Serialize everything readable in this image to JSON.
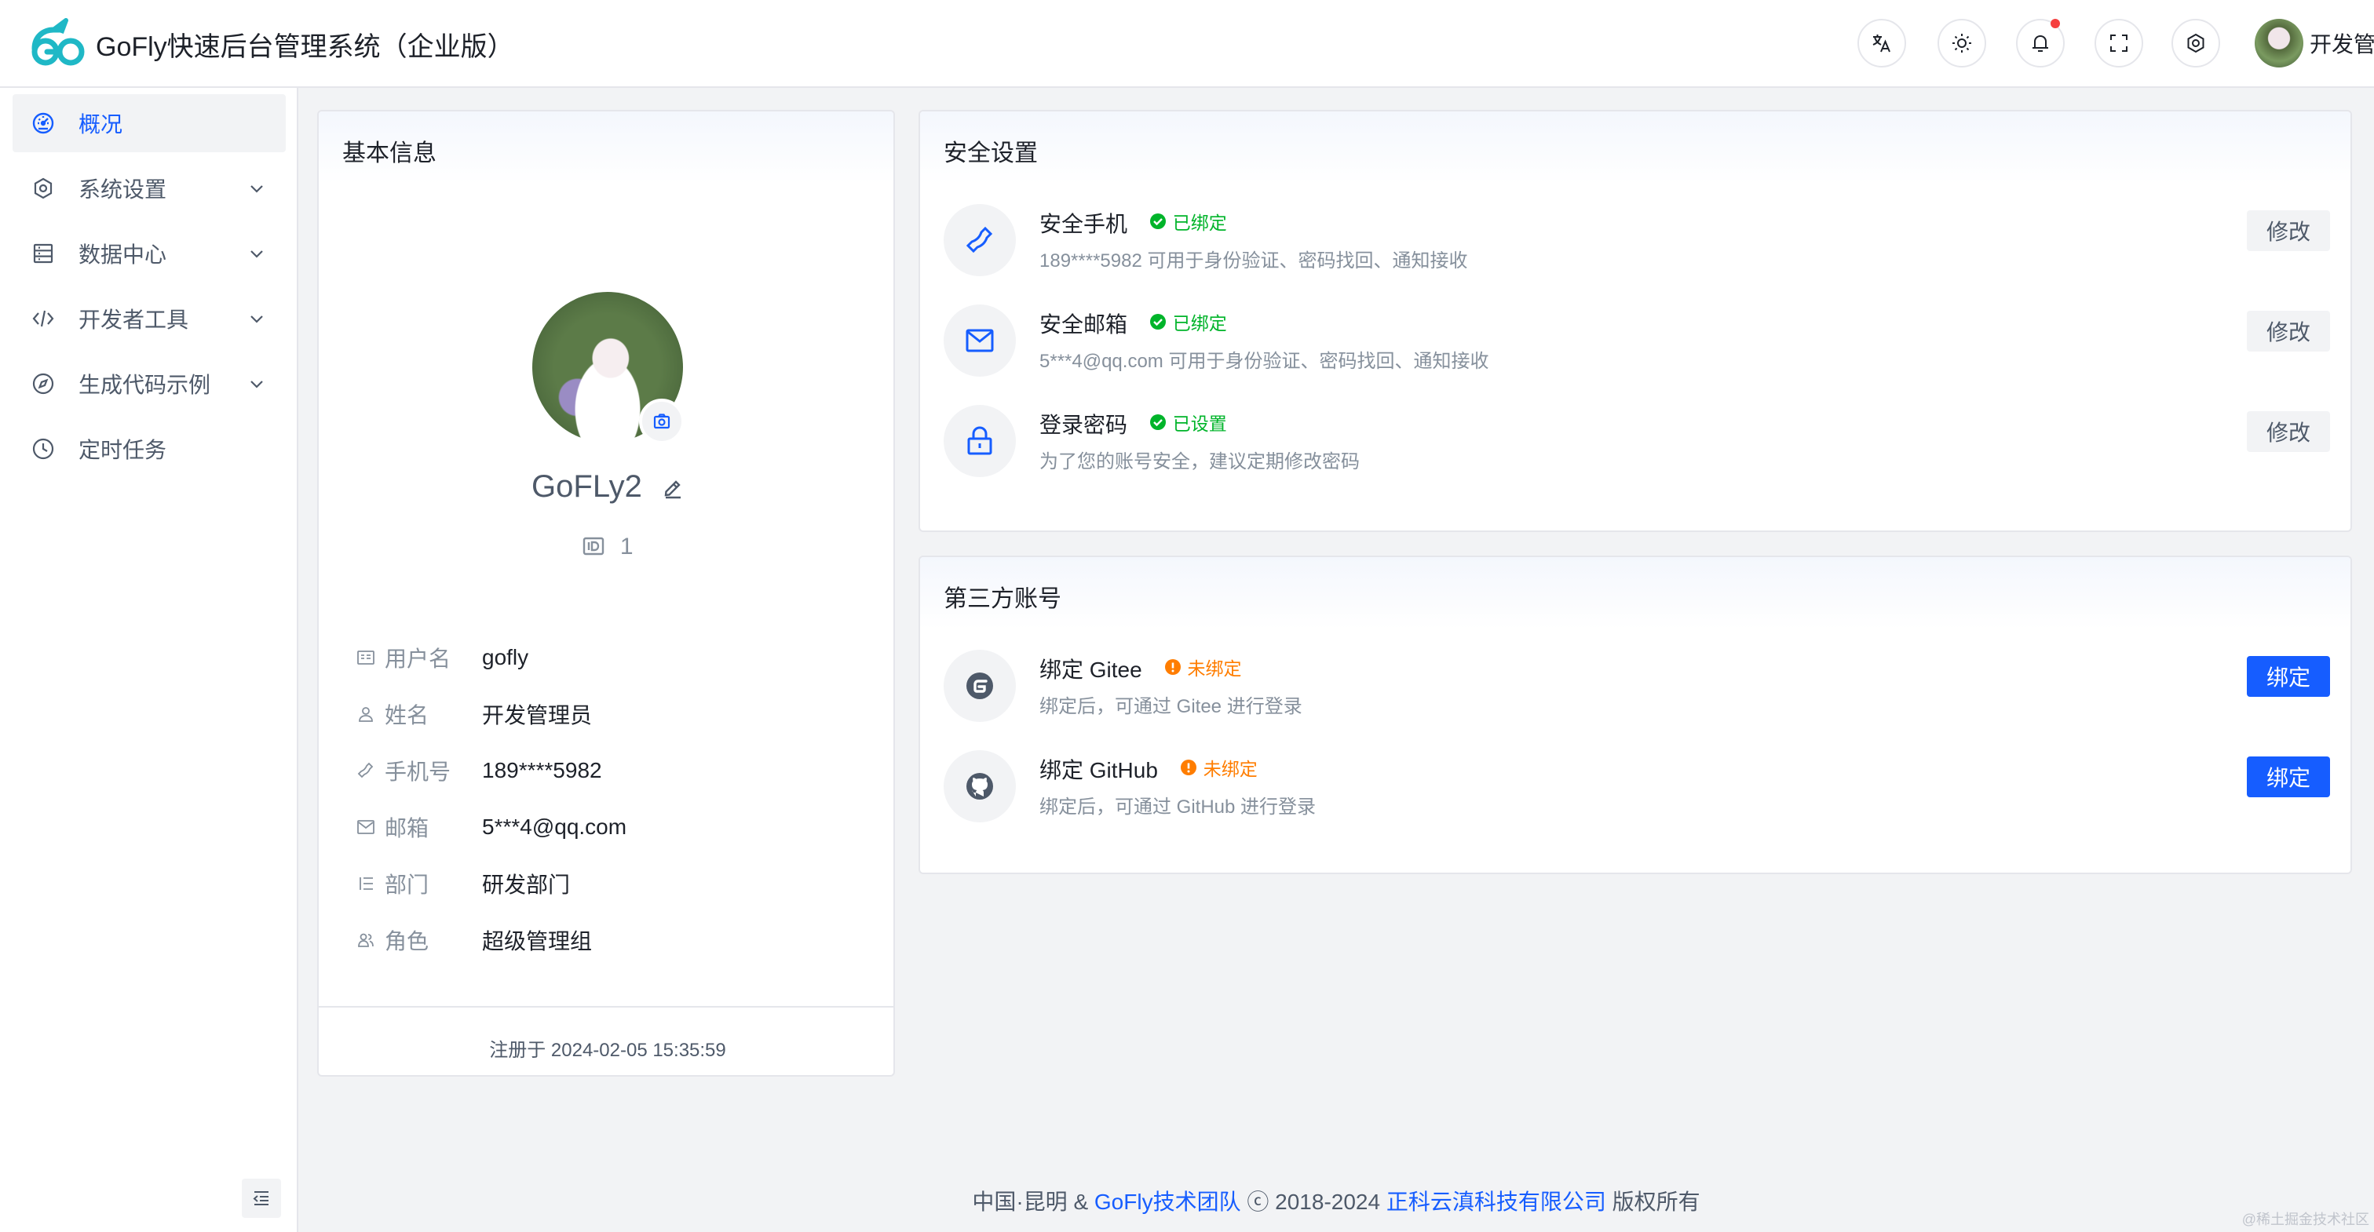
{
  "app": {
    "title": "GoFly快速后台管理系统（企业版）"
  },
  "header": {
    "user_name": "开发管理员",
    "icons": [
      "translate-icon",
      "theme-sun-icon",
      "bell-icon",
      "fullscreen-icon",
      "settings-gear-icon",
      "chevron-down-icon"
    ]
  },
  "sidebar": {
    "items": [
      {
        "label": "概况",
        "icon": "dashboard-icon",
        "active": true,
        "has_children": false
      },
      {
        "label": "系统设置",
        "icon": "gear-icon",
        "active": false,
        "has_children": true
      },
      {
        "label": "数据中心",
        "icon": "database-icon",
        "active": false,
        "has_children": true
      },
      {
        "label": "开发者工具",
        "icon": "code-icon",
        "active": false,
        "has_children": true
      },
      {
        "label": "生成代码示例",
        "icon": "compass-icon",
        "active": false,
        "has_children": true
      },
      {
        "label": "定时任务",
        "icon": "clock-icon",
        "active": false,
        "has_children": false
      }
    ]
  },
  "profile": {
    "card_title": "基本信息",
    "nickname": "GoFLy2",
    "id_value": "1",
    "fields": [
      {
        "label": "用户名",
        "value": "gofly",
        "icon": "id-card-icon"
      },
      {
        "label": "姓名",
        "value": "开发管理员",
        "icon": "user-icon"
      },
      {
        "label": "手机号",
        "value": "189****5982",
        "icon": "phone-icon"
      },
      {
        "label": "邮箱",
        "value": "5***4@qq.com",
        "icon": "mail-icon"
      },
      {
        "label": "部门",
        "value": "研发部门",
        "icon": "list-icon"
      },
      {
        "label": "角色",
        "value": "超级管理组",
        "icon": "user-group-icon"
      }
    ],
    "registered": "注册于 2024-02-05 15:35:59"
  },
  "security": {
    "card_title": "安全设置",
    "items": [
      {
        "title": "安全手机",
        "status": "已绑定",
        "desc": "189****5982 可用于身份验证、密码找回、通知接收",
        "button": "修改",
        "icon": "phone-icon"
      },
      {
        "title": "安全邮箱",
        "status": "已绑定",
        "desc": "5***4@qq.com 可用于身份验证、密码找回、通知接收",
        "button": "修改",
        "icon": "mail-icon"
      },
      {
        "title": "登录密码",
        "status": "已设置",
        "desc": "为了您的账号安全，建议定期修改密码",
        "button": "修改",
        "icon": "lock-icon"
      }
    ]
  },
  "third_party": {
    "card_title": "第三方账号",
    "items": [
      {
        "title": "绑定 Gitee",
        "status": "未绑定",
        "desc": "绑定后，可通过 Gitee 进行登录",
        "button": "绑定",
        "icon": "gitee-icon"
      },
      {
        "title": "绑定 GitHub",
        "status": "未绑定",
        "desc": "绑定后，可通过 GitHub 进行登录",
        "button": "绑定",
        "icon": "github-icon"
      }
    ]
  },
  "footer": {
    "prefix": "中国·昆明 & ",
    "team": "GoFly技术团队",
    "middle": " ⓒ 2018-2024 ",
    "company": "正科云滇科技有限公司",
    "suffix": " 版权所有"
  },
  "watermark": "@稀土掘金技术社区",
  "colors": {
    "primary": "#165dff",
    "success": "#00b42a",
    "warning": "#ff7d00",
    "danger": "#f53f3f"
  }
}
